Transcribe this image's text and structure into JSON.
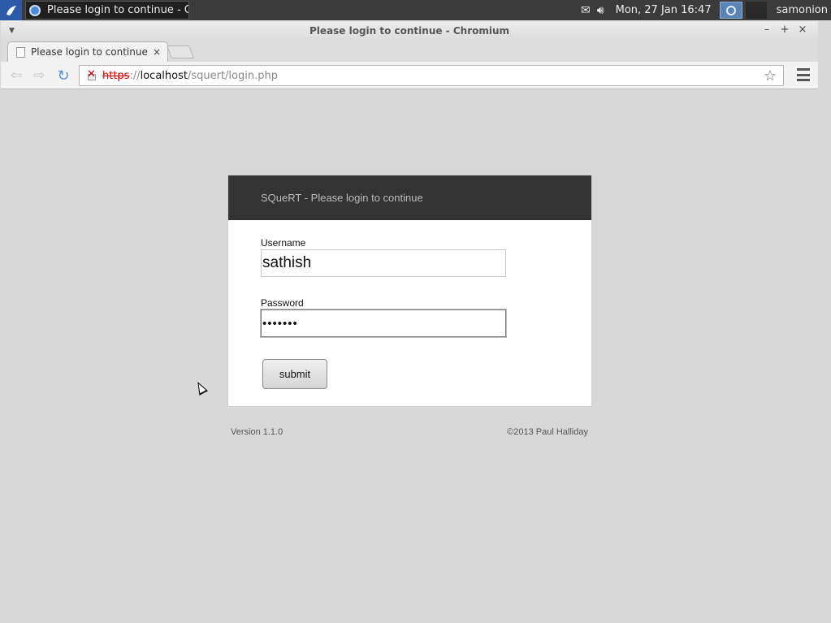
{
  "panel": {
    "task_title": "Please login to continue - C...",
    "clock": "Mon, 27 Jan  16:47",
    "user": "samonion",
    "mail_icon": "mail-icon",
    "volume_icon": "volume-icon"
  },
  "window": {
    "title": "Please login to continue - Chromium",
    "minimize": "–",
    "maximize": "+",
    "close": "×"
  },
  "tab": {
    "label": "Please login to continue",
    "close": "×"
  },
  "toolbar": {
    "back": "⇦",
    "forward": "⇨",
    "reload": "↻",
    "url_scheme": "https",
    "url_sep": "://",
    "url_host": "localhost",
    "url_path": "/squert/login.php",
    "star": "☆"
  },
  "login": {
    "header": "SQueRT - Please login to continue",
    "username_label": "Username",
    "username_value": "sathish",
    "password_label": "Password",
    "password_value": "•••••••",
    "submit_label": "submit",
    "version": "Version 1.1.0",
    "copyright": "©2013 Paul Halliday"
  }
}
